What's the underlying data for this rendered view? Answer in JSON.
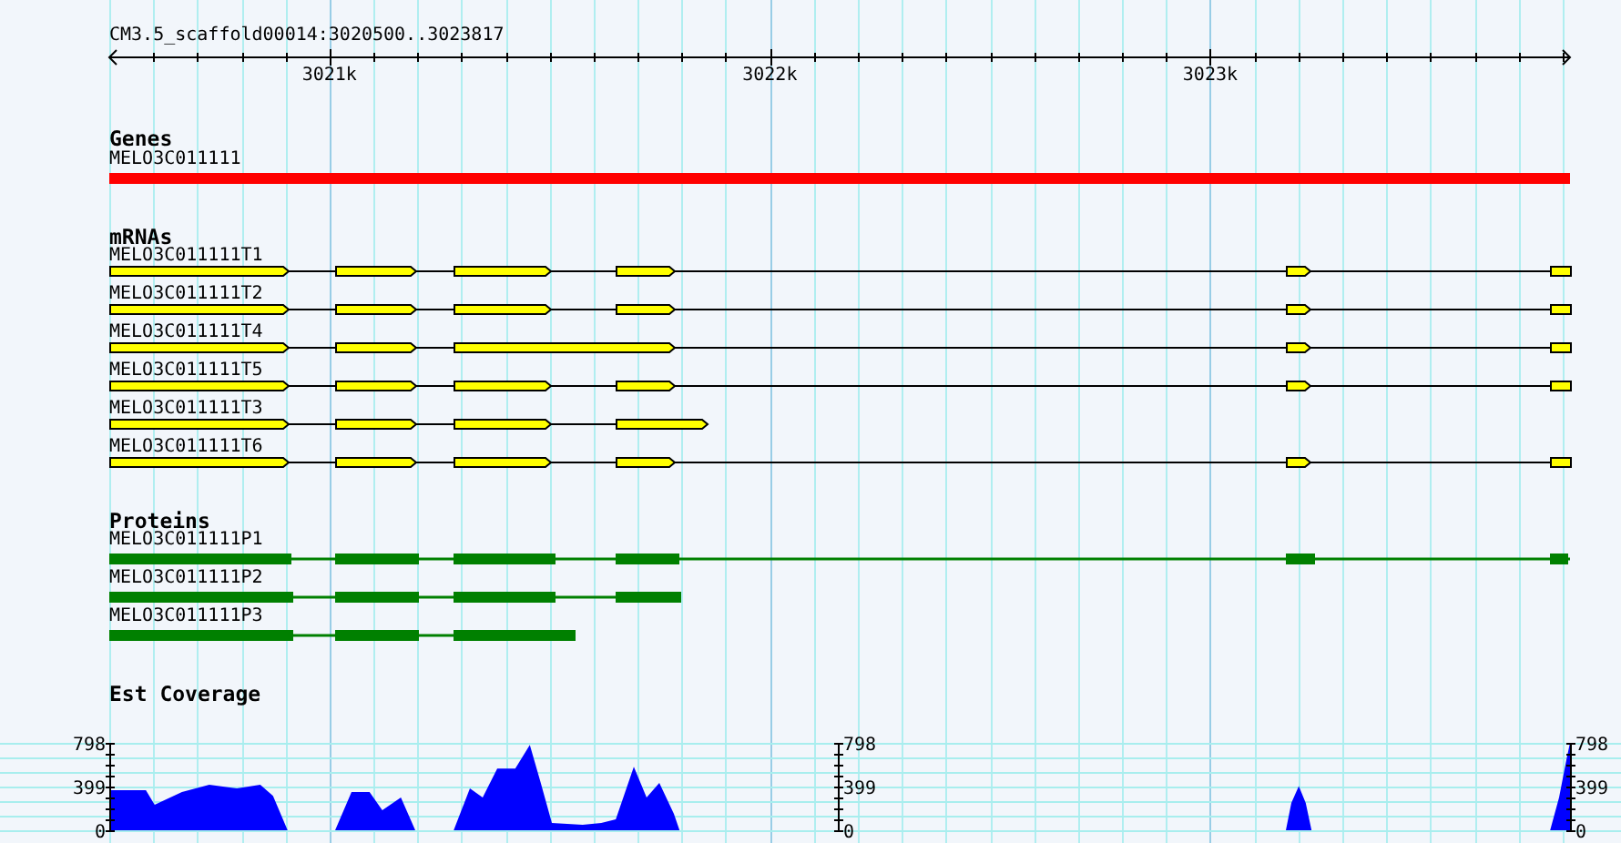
{
  "ruler": {
    "title": "CM3.5_scaffold00014:3020500..3023817",
    "tick_labels": [
      "3021k",
      "3022k",
      "3023k"
    ]
  },
  "tracks": [
    {
      "kind": "genes",
      "title": "Genes",
      "features": [
        {
          "label": "MELO3C011111"
        }
      ]
    },
    {
      "kind": "mrnas",
      "title": "mRNAs",
      "features": [
        {
          "label": "MELO3C011111T1"
        },
        {
          "label": "MELO3C011111T2"
        },
        {
          "label": "MELO3C011111T4"
        },
        {
          "label": "MELO3C011111T5"
        },
        {
          "label": "MELO3C011111T3"
        },
        {
          "label": "MELO3C011111T6"
        }
      ]
    },
    {
      "kind": "proteins",
      "title": "Proteins",
      "features": [
        {
          "label": "MELO3C011111P1"
        },
        {
          "label": "MELO3C011111P2"
        },
        {
          "label": "MELO3C011111P3"
        }
      ]
    },
    {
      "kind": "coverage",
      "title": "Est Coverage",
      "scales": [
        {
          "labels": [
            "798",
            "399",
            "0"
          ]
        },
        {
          "labels": [
            "798",
            "399",
            "0"
          ]
        },
        {
          "labels": [
            "798",
            "399",
            "0"
          ]
        }
      ]
    }
  ]
}
